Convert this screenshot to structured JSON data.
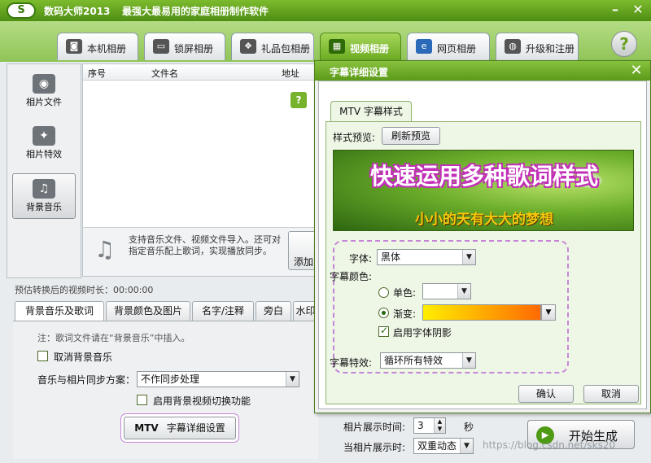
{
  "app": {
    "title": "数码大师2013",
    "slogan": "最强大最易用的家庭相册制作软件",
    "logo": "S"
  },
  "main_tabs": [
    {
      "label": "本机相册",
      "icon": "user-icon"
    },
    {
      "label": "锁屏相册",
      "icon": "monitor-icon"
    },
    {
      "label": "礼品包相册",
      "icon": "gift-icon"
    },
    {
      "label": "视频相册",
      "icon": "film-icon",
      "active": true
    },
    {
      "label": "网页相册",
      "icon": "ie-icon"
    },
    {
      "label": "升级和注册",
      "icon": "globe-icon"
    }
  ],
  "help_glyph": "?",
  "sidebar": [
    {
      "label": "相片文件",
      "icon": "camera-icon"
    },
    {
      "label": "相片特效",
      "icon": "effects-icon"
    },
    {
      "label": "背景音乐",
      "icon": "music-icon",
      "active": true
    }
  ],
  "list": {
    "columns": [
      "序号",
      "文件名",
      "地址"
    ],
    "footer_text": "支持音乐文件、视频文件导入。还可对指定音乐配上歌词，实现播放同步。",
    "add_label": "添加"
  },
  "duration_label": "预估转换后的视频时长：00:00:00",
  "sub_tabs": [
    "背景音乐及歌词",
    "背景颜色及图片",
    "名字/注释",
    "旁白",
    "水印"
  ],
  "music_panel": {
    "tip": "注：歌词文件请在“背景音乐”中插入。",
    "cancel_bg_music": "取消背景音乐",
    "sync_label": "音乐与相片同步方案：",
    "sync_value": "不作同步处理",
    "sync_help": "?",
    "bg_video_switch": "启用背景视频切换功能",
    "mtv_button_prefix": "MTV",
    "mtv_button_label": "字幕详细设置"
  },
  "bottom": {
    "display_time_label": "相片展示时间:",
    "display_time_value": "3",
    "display_time_unit": "秒",
    "transition_label": "当相片展示时:",
    "transition_value": "双重动态",
    "start_label": "开始生成",
    "watermark": "https://blog.csdn.net/sks20"
  },
  "dialog": {
    "title": "字幕详细设置",
    "tab_label": "MTV 字幕样式",
    "preview_label": "样式预览:",
    "refresh_label": "刷新预览",
    "preview_line1": "快速运用多种歌词样式",
    "preview_line2": "小小的天有大大的梦想",
    "font_label": "字体:",
    "font_value": "黑体",
    "color_label": "字幕颜色:",
    "single_color_label": "单色:",
    "gradient_label": "渐变:",
    "gradient_colors": [
      "#ffee00",
      "#ff6a00"
    ],
    "shadow_label": "启用字体阴影",
    "effect_label": "字幕特效:",
    "effect_value": "循环所有特效",
    "ok_label": "确认",
    "cancel_label": "取消"
  },
  "colors": {
    "title_bar": "#5b9919",
    "active_tab": "#6bab22",
    "highlight_ring": "#c785d8",
    "preview_text_outline": "#c22fb9",
    "preview_subtitle": "#f2c80c"
  }
}
